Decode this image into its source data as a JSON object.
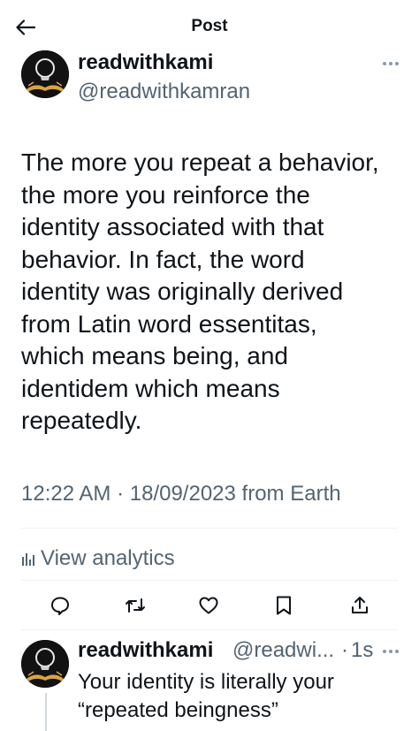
{
  "topbar": {
    "title": "Post",
    "back_icon": "back-arrow-icon"
  },
  "post": {
    "author_name": "readwithkami",
    "author_handle": "@readwithkamran",
    "text_lines": [
      "The more you repeat a behavior,",
      "the more you reinforce the",
      "identity associated with that",
      "behavior. In fact, the word",
      "identity was originally derived",
      "from Latin word essentitas,",
      "which means being, and",
      "identidem which means",
      "repeatedly."
    ],
    "time": "12:22 AM",
    "separator": "·",
    "date": "18/09/2023",
    "source": "from Earth",
    "analytics_label": "View analytics"
  },
  "actions": {
    "reply_icon": "reply-icon",
    "repost_icon": "repost-icon",
    "like_icon": "heart-icon",
    "bookmark_icon": "bookmark-icon",
    "share_icon": "share-icon"
  },
  "reply": {
    "author_name": "readwithkami",
    "author_handle": "@readwi...",
    "separator": "·",
    "age": "1s",
    "text_lines": [
      "Your identity is literally your",
      "“repeated beingness”"
    ]
  },
  "colors": {
    "text": "#0f1419",
    "secondary": "#536471",
    "divider": "#eff3f4"
  }
}
